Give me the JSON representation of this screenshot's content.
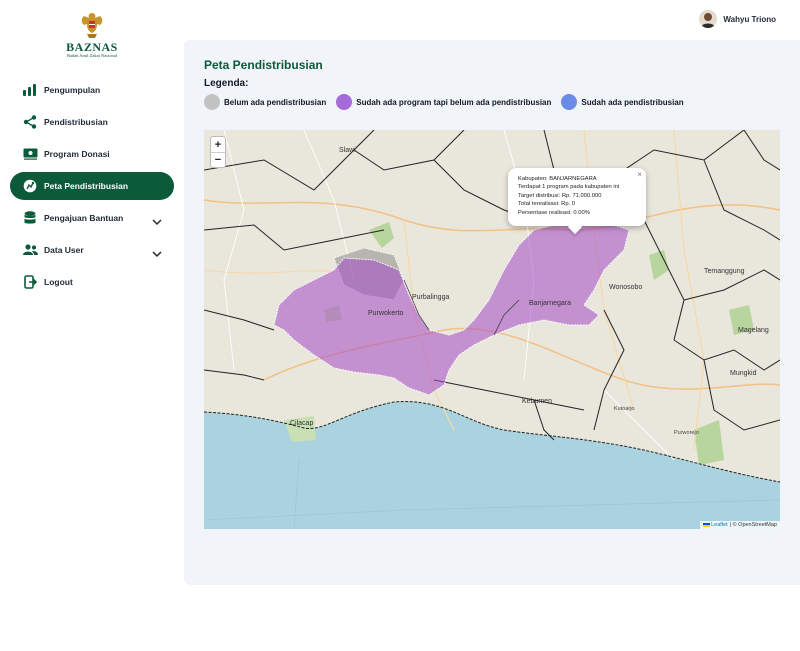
{
  "brand": {
    "name": "BAZNAS",
    "subtitle": "Badan Amil Zakat Nasional"
  },
  "user": {
    "name": "Wahyu Triono"
  },
  "sidebar": {
    "items": [
      {
        "label": "Pengumpulan",
        "icon": "bar-chart-icon",
        "active": false
      },
      {
        "label": "Pendistribusian",
        "icon": "share-icon",
        "active": false
      },
      {
        "label": "Program Donasi",
        "icon": "money-icon",
        "active": false
      },
      {
        "label": "Peta Pendistribusian",
        "icon": "map-pin-icon",
        "active": true
      },
      {
        "label": "Pengajuan Bantuan",
        "icon": "database-icon",
        "active": false,
        "expandable": true
      },
      {
        "label": "Data User",
        "icon": "users-icon",
        "active": false,
        "expandable": true
      },
      {
        "label": "Logout",
        "icon": "logout-icon",
        "active": false
      }
    ]
  },
  "page": {
    "title": "Peta Pendistribusian"
  },
  "legend": {
    "title": "Legenda:",
    "items": [
      {
        "label": "Belum ada pendistribusian",
        "color": "#c2c2c2"
      },
      {
        "label": "Sudah ada program tapi belum ada pendistribusian",
        "color": "#a66bdb"
      },
      {
        "label": "Sudah ada pendistribusian",
        "color": "#6b8be8"
      }
    ]
  },
  "map": {
    "zoom_in": "+",
    "zoom_out": "−",
    "attribution": {
      "leaflet": "Leaflet",
      "osm": "| © OpenStreetMap"
    },
    "popup": {
      "close": "×",
      "lines": [
        "Kabupaten: BANJARNEGARA",
        "Terdapat 1 program pada kabupaten ini",
        "Target distribusi: Rp. 71.000.000",
        "Total terealisasi: Rp. 0",
        "Persentase realisasi: 0.00%"
      ]
    },
    "place_labels": {
      "slawi": "Slawi",
      "purbalingga": "Purbalingga",
      "purwokerto": "Purwokerto",
      "banjarnegara": "Banjarnegara",
      "wonosobo": "Wonosobo",
      "temanggung": "Temanggung",
      "magelang": "Magelang",
      "mungkid": "Mungkid",
      "kebumen": "Kebumen",
      "cilacap": "Cilacap",
      "kutoarjo": "Kutoarjo",
      "purworejo": "Purworejo"
    }
  }
}
